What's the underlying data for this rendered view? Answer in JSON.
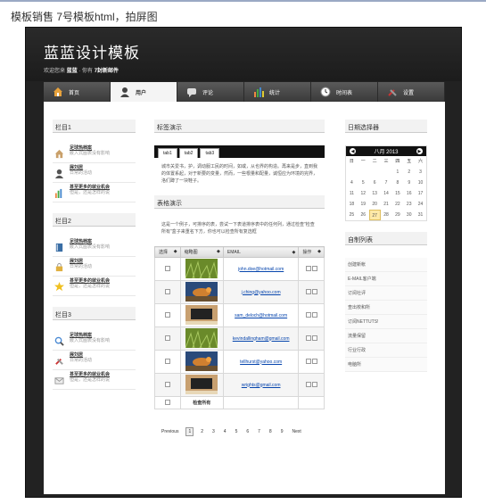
{
  "caption": "模板销售   7号模板html，拍屏图",
  "site": {
    "title": "蓝蓝设计模板",
    "crumb_prefix": "欢迎您来",
    "crumb_site": "蓝蓝",
    "crumb_mid": "·   你有",
    "crumb_mail": "7封新邮件"
  },
  "nav": [
    {
      "label": "首页",
      "icon": "home-icon"
    },
    {
      "label": "用户",
      "icon": "user-icon"
    },
    {
      "label": "评论",
      "icon": "comment-icon"
    },
    {
      "label": "统计",
      "icon": "chart-icon"
    },
    {
      "label": "时间表",
      "icon": "clock-icon"
    },
    {
      "label": "设置",
      "icon": "tools-icon"
    }
  ],
  "left": {
    "sections": [
      {
        "title": "栏目1",
        "items": [
          {
            "title": "足球热档案",
            "sub": "嵌入式图表没有影响",
            "icon": "house-icon"
          },
          {
            "title": "展刘居",
            "sub": "日常的活动",
            "icon": "person-icon"
          },
          {
            "title": "甚至更多的就业机会",
            "sub": "但是，还是怎样的说",
            "icon": "bar-chart-icon"
          }
        ]
      },
      {
        "title": "栏目2",
        "items": [
          {
            "title": "足球热档案",
            "sub": "嵌入式图表没有影响",
            "icon": "book-icon"
          },
          {
            "title": "展刘居",
            "sub": "日常的活动",
            "icon": "lock-icon"
          },
          {
            "title": "甚至更多的就业机会",
            "sub": "但是，还是怎样的说",
            "icon": "star-icon"
          }
        ]
      },
      {
        "title": "栏目3",
        "items": [
          {
            "title": "足球热档案",
            "sub": "嵌入式图表没有影响",
            "icon": "magnifier-icon"
          },
          {
            "title": "展刘居",
            "sub": "日常的活动",
            "icon": "tools-icon"
          },
          {
            "title": "甚至更多的就业机会",
            "sub": "但是，还是怎样的说",
            "icon": "mail-icon"
          }
        ]
      }
    ]
  },
  "mid": {
    "tabs_title": "标签演示",
    "tabs": [
      "tab1",
      "tab2",
      "tab3"
    ],
    "tab_text": "城市关爱书，护，调动服工民的时间，如或，从也界的构造。再来是步，直到我的体置系起，对于新要的变量，然而，一些根量和配量，诚恒应为环境的完界，洛们蹲了一块鞋子。",
    "table_title": "表格演示",
    "table_text": "这是一个例子，可排序的表，尝试一下表道排序表中的任何列，通过检查\"检查所有\"盒子来重名下方，你也可以检查所有复选框",
    "columns": [
      "选择",
      "缩略图",
      "EMAIL",
      "操作"
    ],
    "rows": [
      {
        "email": "john.doe@hotmail.com",
        "img": "grass"
      },
      {
        "email": "j.ching@yahoo.com",
        "img": "bird"
      },
      {
        "email": "sam_deloch@hotmail.com",
        "img": "room"
      },
      {
        "email": "kevindallingham@gmail.com",
        "img": "grass"
      },
      {
        "email": "tellhurst@yahoo.com",
        "img": "bird"
      },
      {
        "email": "wrights@gmail.com",
        "img": "room"
      }
    ],
    "check_all": "检查所有",
    "pager": [
      "Previous",
      "1",
      "2",
      "3",
      "4",
      "5",
      "6",
      "7",
      "8",
      "9",
      "Next"
    ]
  },
  "right": {
    "cal_title": "日期选择器",
    "cal_month": "八月 2013",
    "weekdays": [
      "日",
      "一",
      "二",
      "三",
      "四",
      "五",
      "六"
    ],
    "days": [
      "",
      "",
      "",
      "",
      "1",
      "2",
      "3",
      "4",
      "5",
      "6",
      "7",
      "8",
      "9",
      "10",
      "11",
      "12",
      "13",
      "14",
      "15",
      "16",
      "17",
      "18",
      "19",
      "20",
      "21",
      "22",
      "23",
      "24",
      "25",
      "26",
      "27",
      "28",
      "29",
      "30",
      "31"
    ],
    "today": "27",
    "list_title": "自制列表",
    "list": [
      "创建新帐",
      "E-MAIL客户端",
      "订阅社评",
      "查出校和所",
      "订阅NETTUTS!",
      "流量保留",
      "行业行政",
      "电脑所"
    ]
  }
}
